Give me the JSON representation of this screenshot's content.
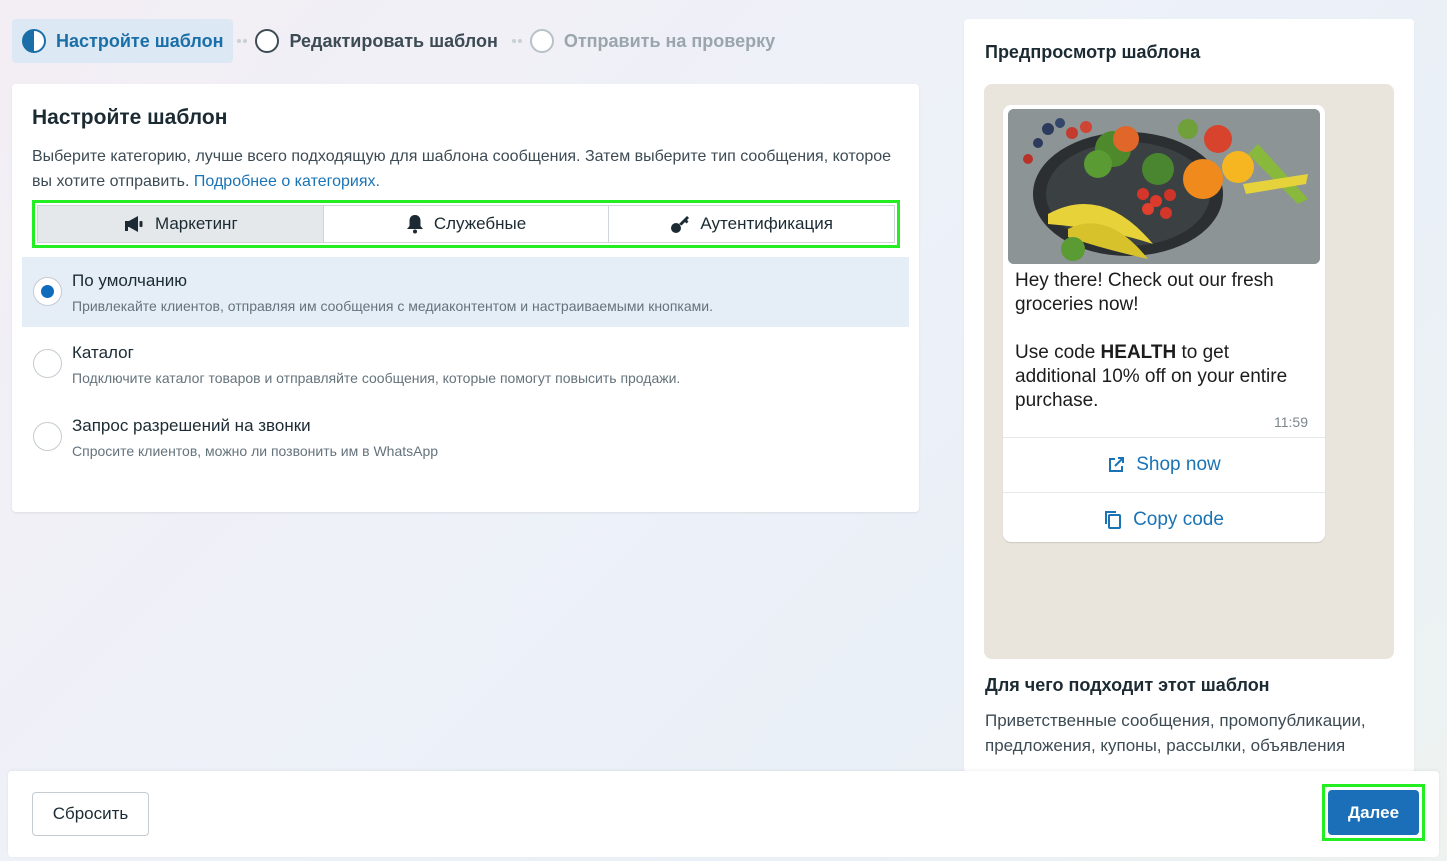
{
  "stepper": {
    "steps": [
      {
        "label": "Настройте шаблон",
        "state": "active"
      },
      {
        "label": "Редактировать шаблон",
        "state": "next"
      },
      {
        "label": "Отправить на проверку",
        "state": "todo"
      }
    ]
  },
  "setup": {
    "title": "Настройте шаблон",
    "description": "Выберите категорию, лучше всего подходящую для шаблона сообщения. Затем выберите тип сообщения, которое вы хотите отправить.",
    "learn_more_link": "Подробнее о категориях.",
    "category_tabs": [
      {
        "label": "Маркетинг",
        "icon": "megaphone-icon",
        "selected": true
      },
      {
        "label": "Служебные",
        "icon": "bell-icon",
        "selected": false
      },
      {
        "label": "Аутентификация",
        "icon": "key-icon",
        "selected": false
      }
    ],
    "options": [
      {
        "title": "По умолчанию",
        "subtitle": "Привлекайте клиентов, отправляя им сообщения с медиаконтентом и настраиваемыми кнопками.",
        "selected": true
      },
      {
        "title": "Каталог",
        "subtitle": "Подключите каталог товаров и отправляйте сообщения, которые помогут повысить продажи.",
        "selected": false
      },
      {
        "title": "Запрос разрешений на звонки",
        "subtitle": "Спросите клиентов, можно ли позвонить им в WhatsApp",
        "selected": false
      }
    ]
  },
  "preview": {
    "title": "Предпросмотр шаблона",
    "message": {
      "line1": "Hey there! Check out our fresh groceries now!",
      "line2_prefix": "Use code ",
      "line2_bold": "HEALTH",
      "line2_suffix": " to get additional 10% off on your entire purchase.",
      "time": "11:59"
    },
    "buttons": {
      "shop_now": "Shop now",
      "copy_code": "Copy code"
    },
    "use_case_title": "Для чего подходит этот шаблон",
    "use_case_desc": "Приветственные сообщения, промопубликации, предложения, купоны, рассылки, объявления"
  },
  "footer": {
    "reset_label": "Сбросить",
    "next_label": "Далее"
  },
  "colors": {
    "accent": "#1a6fb8",
    "highlight": "#22ee22",
    "selected_bg": "#e5eef7"
  }
}
